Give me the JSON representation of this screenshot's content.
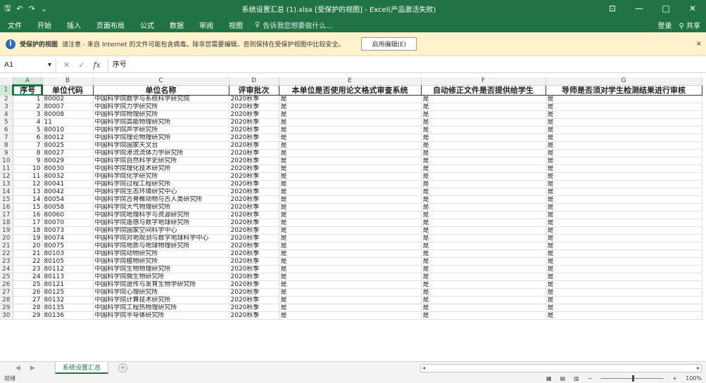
{
  "window": {
    "title": "系统设置汇总 (1).xlsx [受保护的视图] - Excel(产品激活失败)",
    "min": "—",
    "max": "□",
    "close": "✕"
  },
  "ribbon": {
    "tabs": [
      "文件",
      "开始",
      "插入",
      "页面布局",
      "公式",
      "数据",
      "审阅",
      "视图"
    ],
    "tell_me": "告诉我您想要做什么...",
    "login": "登录",
    "share": "共享"
  },
  "protected_view": {
    "title": "受保护的视图",
    "message": "请注意 - 来自 Internet 的文件可能包含病毒。除非您需要编辑，否则保持在受保护视图中比较安全。",
    "enable_button": "启用编辑(E)"
  },
  "formula_bar": {
    "name_box": "A1",
    "cancel": "✕",
    "enter": "✓",
    "fx": "fx",
    "formula": "序号"
  },
  "columns": [
    "A",
    "B",
    "C",
    "D",
    "E",
    "F",
    "G"
  ],
  "headers": [
    "序号",
    "单位代码",
    "单位名称",
    "评审批次",
    "本单位是否使用论文格式审查系统",
    "自动修正文件是否提供给学生",
    "导师是否须对学生检测结果进行审核"
  ],
  "rows": [
    [
      "1",
      "80002",
      "中国科学院数学与系统科学研究院",
      "2020秋季",
      "是",
      "是",
      "是"
    ],
    [
      "2",
      "80007",
      "中国科学院力学研究所",
      "2020秋季",
      "是",
      "是",
      "是"
    ],
    [
      "3",
      "80008",
      "中国科学院物理研究所",
      "2020秋季",
      "是",
      "是",
      "是"
    ],
    [
      "4",
      "11",
      "中国科学院高能物理研究所",
      "2020秋季",
      "是",
      "是",
      "是"
    ],
    [
      "5",
      "80010",
      "中国科学院声学研究所",
      "2020秋季",
      "是",
      "是",
      "是"
    ],
    [
      "6",
      "80012",
      "中国科学院理论物理研究所",
      "2020秋季",
      "是",
      "是",
      "是"
    ],
    [
      "7",
      "80025",
      "中国科学院国家天文台",
      "2020秋季",
      "是",
      "是",
      "是"
    ],
    [
      "8",
      "80027",
      "中国科学院渗流流体力学研究所",
      "2020秋季",
      "是",
      "是",
      "是"
    ],
    [
      "9",
      "80029",
      "中国科学院自然科学史研究所",
      "2020秋季",
      "是",
      "是",
      "是"
    ],
    [
      "10",
      "80030",
      "中国科学院理化技术研究所",
      "2020秋季",
      "是",
      "是",
      "是"
    ],
    [
      "11",
      "80032",
      "中国科学院化学研究所",
      "2020秋季",
      "是",
      "是",
      "是"
    ],
    [
      "12",
      "80041",
      "中国科学院过程工程研究所",
      "2020秋季",
      "是",
      "是",
      "是"
    ],
    [
      "13",
      "80042",
      "中国科学院生态环境研究中心",
      "2020秋季",
      "是",
      "是",
      "是"
    ],
    [
      "14",
      "80054",
      "中国科学院古脊椎动物与古人类研究所",
      "2020秋季",
      "是",
      "是",
      "是"
    ],
    [
      "15",
      "80058",
      "中国科学院大气物理研究所",
      "2020秋季",
      "是",
      "是",
      "是"
    ],
    [
      "16",
      "80060",
      "中国科学院地理科学与资源研究所",
      "2020秋季",
      "是",
      "是",
      "是"
    ],
    [
      "17",
      "80070",
      "中国科学院遥感与数字地球研究所",
      "2020秋季",
      "是",
      "是",
      "是"
    ],
    [
      "18",
      "80073",
      "中国科学院国家空间科学中心",
      "2020秋季",
      "是",
      "是",
      "是"
    ],
    [
      "19",
      "80074",
      "中国科学院对地观测与数字地球科学中心",
      "2020秋季",
      "是",
      "是",
      "是"
    ],
    [
      "20",
      "80075",
      "中国科学院地质与地球物理研究所",
      "2020秋季",
      "是",
      "是",
      "是"
    ],
    [
      "21",
      "80103",
      "中国科学院动物研究所",
      "2020秋季",
      "是",
      "是",
      "是"
    ],
    [
      "22",
      "80105",
      "中国科学院植物研究所",
      "2020秋季",
      "是",
      "是",
      "是"
    ],
    [
      "23",
      "80112",
      "中国科学院生物物理研究所",
      "2020秋季",
      "是",
      "是",
      "是"
    ],
    [
      "24",
      "80113",
      "中国科学院微生物研究所",
      "2020秋季",
      "是",
      "是",
      "是"
    ],
    [
      "25",
      "80121",
      "中国科学院遗传与发育生物学研究所",
      "2020秋季",
      "是",
      "是",
      "是"
    ],
    [
      "26",
      "80125",
      "中国科学院心理研究所",
      "2020秋季",
      "是",
      "是",
      "是"
    ],
    [
      "27",
      "80132",
      "中国科学院计算技术研究所",
      "2020秋季",
      "是",
      "是",
      "是"
    ],
    [
      "28",
      "80135",
      "中国科学院工程热物理研究所",
      "2020秋季",
      "是",
      "是",
      "是"
    ],
    [
      "29",
      "80136",
      "中国科学院半导体研究所",
      "2020秋季",
      "是",
      "是",
      "是"
    ]
  ],
  "sheet_tab": "系统设置汇总",
  "status": {
    "ready": "就绪",
    "zoom": "100%"
  },
  "colors": {
    "accent": "#217346",
    "protected_bg": "#fff2cc"
  }
}
